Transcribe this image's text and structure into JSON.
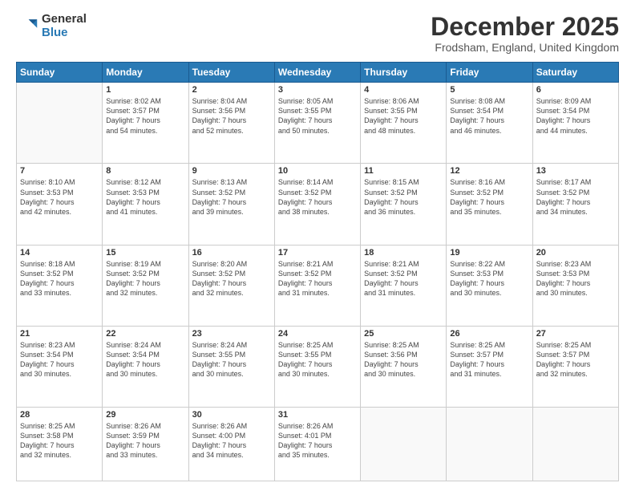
{
  "header": {
    "logo_general": "General",
    "logo_blue": "Blue",
    "title": "December 2025",
    "location": "Frodsham, England, United Kingdom"
  },
  "days_of_week": [
    "Sunday",
    "Monday",
    "Tuesday",
    "Wednesday",
    "Thursday",
    "Friday",
    "Saturday"
  ],
  "weeks": [
    [
      {
        "day": "",
        "text": ""
      },
      {
        "day": "1",
        "text": "Sunrise: 8:02 AM\nSunset: 3:57 PM\nDaylight: 7 hours\nand 54 minutes."
      },
      {
        "day": "2",
        "text": "Sunrise: 8:04 AM\nSunset: 3:56 PM\nDaylight: 7 hours\nand 52 minutes."
      },
      {
        "day": "3",
        "text": "Sunrise: 8:05 AM\nSunset: 3:55 PM\nDaylight: 7 hours\nand 50 minutes."
      },
      {
        "day": "4",
        "text": "Sunrise: 8:06 AM\nSunset: 3:55 PM\nDaylight: 7 hours\nand 48 minutes."
      },
      {
        "day": "5",
        "text": "Sunrise: 8:08 AM\nSunset: 3:54 PM\nDaylight: 7 hours\nand 46 minutes."
      },
      {
        "day": "6",
        "text": "Sunrise: 8:09 AM\nSunset: 3:54 PM\nDaylight: 7 hours\nand 44 minutes."
      }
    ],
    [
      {
        "day": "7",
        "text": "Sunrise: 8:10 AM\nSunset: 3:53 PM\nDaylight: 7 hours\nand 42 minutes."
      },
      {
        "day": "8",
        "text": "Sunrise: 8:12 AM\nSunset: 3:53 PM\nDaylight: 7 hours\nand 41 minutes."
      },
      {
        "day": "9",
        "text": "Sunrise: 8:13 AM\nSunset: 3:52 PM\nDaylight: 7 hours\nand 39 minutes."
      },
      {
        "day": "10",
        "text": "Sunrise: 8:14 AM\nSunset: 3:52 PM\nDaylight: 7 hours\nand 38 minutes."
      },
      {
        "day": "11",
        "text": "Sunrise: 8:15 AM\nSunset: 3:52 PM\nDaylight: 7 hours\nand 36 minutes."
      },
      {
        "day": "12",
        "text": "Sunrise: 8:16 AM\nSunset: 3:52 PM\nDaylight: 7 hours\nand 35 minutes."
      },
      {
        "day": "13",
        "text": "Sunrise: 8:17 AM\nSunset: 3:52 PM\nDaylight: 7 hours\nand 34 minutes."
      }
    ],
    [
      {
        "day": "14",
        "text": "Sunrise: 8:18 AM\nSunset: 3:52 PM\nDaylight: 7 hours\nand 33 minutes."
      },
      {
        "day": "15",
        "text": "Sunrise: 8:19 AM\nSunset: 3:52 PM\nDaylight: 7 hours\nand 32 minutes."
      },
      {
        "day": "16",
        "text": "Sunrise: 8:20 AM\nSunset: 3:52 PM\nDaylight: 7 hours\nand 32 minutes."
      },
      {
        "day": "17",
        "text": "Sunrise: 8:21 AM\nSunset: 3:52 PM\nDaylight: 7 hours\nand 31 minutes."
      },
      {
        "day": "18",
        "text": "Sunrise: 8:21 AM\nSunset: 3:52 PM\nDaylight: 7 hours\nand 31 minutes."
      },
      {
        "day": "19",
        "text": "Sunrise: 8:22 AM\nSunset: 3:53 PM\nDaylight: 7 hours\nand 30 minutes."
      },
      {
        "day": "20",
        "text": "Sunrise: 8:23 AM\nSunset: 3:53 PM\nDaylight: 7 hours\nand 30 minutes."
      }
    ],
    [
      {
        "day": "21",
        "text": "Sunrise: 8:23 AM\nSunset: 3:54 PM\nDaylight: 7 hours\nand 30 minutes."
      },
      {
        "day": "22",
        "text": "Sunrise: 8:24 AM\nSunset: 3:54 PM\nDaylight: 7 hours\nand 30 minutes."
      },
      {
        "day": "23",
        "text": "Sunrise: 8:24 AM\nSunset: 3:55 PM\nDaylight: 7 hours\nand 30 minutes."
      },
      {
        "day": "24",
        "text": "Sunrise: 8:25 AM\nSunset: 3:55 PM\nDaylight: 7 hours\nand 30 minutes."
      },
      {
        "day": "25",
        "text": "Sunrise: 8:25 AM\nSunset: 3:56 PM\nDaylight: 7 hours\nand 30 minutes."
      },
      {
        "day": "26",
        "text": "Sunrise: 8:25 AM\nSunset: 3:57 PM\nDaylight: 7 hours\nand 31 minutes."
      },
      {
        "day": "27",
        "text": "Sunrise: 8:25 AM\nSunset: 3:57 PM\nDaylight: 7 hours\nand 32 minutes."
      }
    ],
    [
      {
        "day": "28",
        "text": "Sunrise: 8:25 AM\nSunset: 3:58 PM\nDaylight: 7 hours\nand 32 minutes."
      },
      {
        "day": "29",
        "text": "Sunrise: 8:26 AM\nSunset: 3:59 PM\nDaylight: 7 hours\nand 33 minutes."
      },
      {
        "day": "30",
        "text": "Sunrise: 8:26 AM\nSunset: 4:00 PM\nDaylight: 7 hours\nand 34 minutes."
      },
      {
        "day": "31",
        "text": "Sunrise: 8:26 AM\nSunset: 4:01 PM\nDaylight: 7 hours\nand 35 minutes."
      },
      {
        "day": "",
        "text": ""
      },
      {
        "day": "",
        "text": ""
      },
      {
        "day": "",
        "text": ""
      }
    ]
  ]
}
